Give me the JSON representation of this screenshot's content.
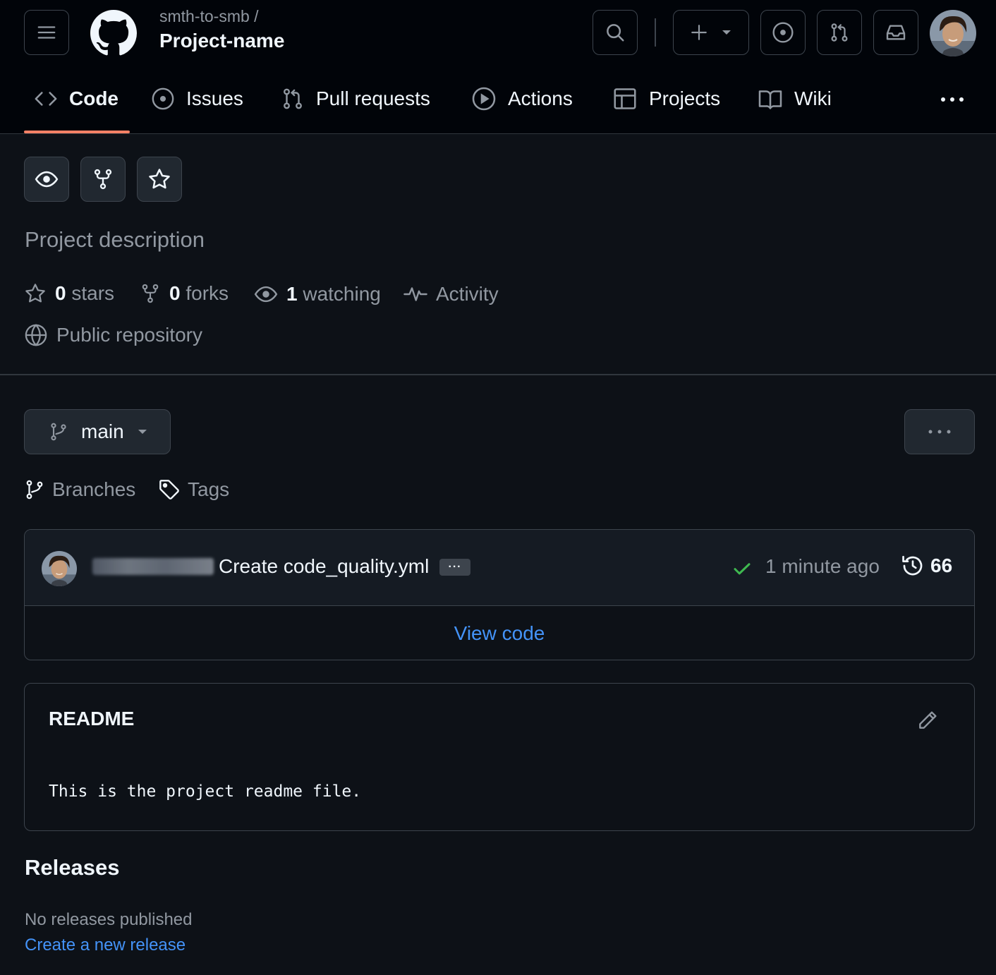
{
  "header": {
    "owner": "smth-to-smb /",
    "repo_name": "Project-name"
  },
  "tabs": [
    {
      "label": "Code",
      "icon": "code-icon",
      "selected": true
    },
    {
      "label": "Issues",
      "icon": "issue-opened-icon"
    },
    {
      "label": "Pull requests",
      "icon": "git-pull-request-icon"
    },
    {
      "label": "Actions",
      "icon": "play-icon"
    },
    {
      "label": "Projects",
      "icon": "table-icon"
    },
    {
      "label": "Wiki",
      "icon": "book-icon"
    }
  ],
  "repo": {
    "description": "Project description",
    "stars_count": "0",
    "stars_label": "stars",
    "forks_count": "0",
    "forks_label": "forks",
    "watching_count": "1",
    "watching_label": "watching",
    "activity_label": "Activity",
    "visibility": "Public repository"
  },
  "branch": {
    "current": "main",
    "branches_label": "Branches",
    "tags_label": "Tags"
  },
  "commit": {
    "message": "Create code_quality.yml",
    "status": "success",
    "time": "1 minute ago",
    "count": "66"
  },
  "view_code_label": "View code",
  "readme": {
    "title": "README",
    "content": "This is the project readme file."
  },
  "releases": {
    "title": "Releases",
    "none_text": "No releases published",
    "create_link": "Create a new release"
  },
  "colors": {
    "background": "#0d1117",
    "header_bg": "#010409",
    "accent_underline": "#f78166",
    "link": "#4493f8",
    "success": "#3fb950"
  }
}
